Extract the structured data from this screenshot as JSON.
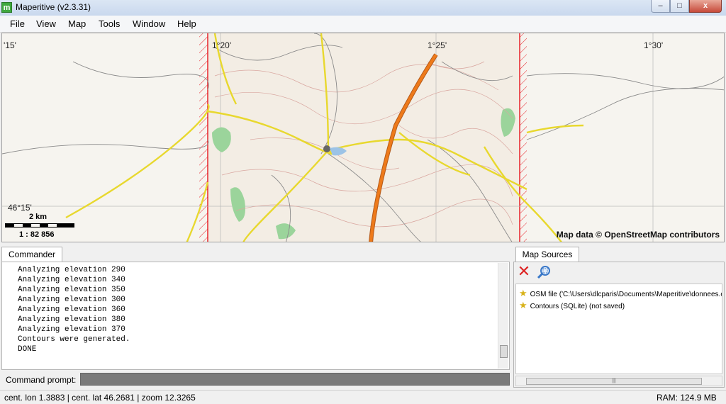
{
  "window": {
    "title": "Maperitive (v2.3.31)",
    "app_icon": "m",
    "minimize": "–",
    "maximize": "□",
    "close": "x"
  },
  "menu": {
    "file": "File",
    "view": "View",
    "map": "Map",
    "tools": "Tools",
    "window": "Window",
    "help": "Help"
  },
  "map": {
    "coords": {
      "lon_115": "'15'",
      "lon_120": "1°20'",
      "lon_125": "1°25'",
      "lon_130": "1°30'",
      "lat_4615": "46°15'"
    },
    "scale_distance": "2 km",
    "scale_ratio": "1 : 82 856",
    "attribution": "Map data © OpenStreetMap contributors",
    "colors": {
      "highway": "#ee7a1a",
      "road": "#e8d82e",
      "boundary": "#e8232a",
      "woods": "#9bd49b"
    }
  },
  "commander": {
    "tab_label": "Commander",
    "lines": [
      "Analyzing elevation 290",
      "Analyzing elevation 340",
      "Analyzing elevation 350",
      "Analyzing elevation 300",
      "Analyzing elevation 360",
      "Analyzing elevation 380",
      "Analyzing elevation 370",
      "Contours were generated.",
      "DONE"
    ],
    "prompt_label": "Command prompt:"
  },
  "sources": {
    "tab_label": "Map Sources",
    "items": [
      {
        "icon": "star-icon",
        "label": "OSM file ('C:\\Users\\dlcparis\\Documents\\Maperitive\\donnees.c"
      },
      {
        "icon": "star-icon",
        "label": "Contours (SQLite) (not saved)"
      }
    ],
    "remove_icon": "✕",
    "hscroll_grip": "|||"
  },
  "status": {
    "location": "cent. lon 1.3883 | cent. lat 46.2681 | zoom 12.3265",
    "ram": "RAM: 124.9 MB"
  }
}
